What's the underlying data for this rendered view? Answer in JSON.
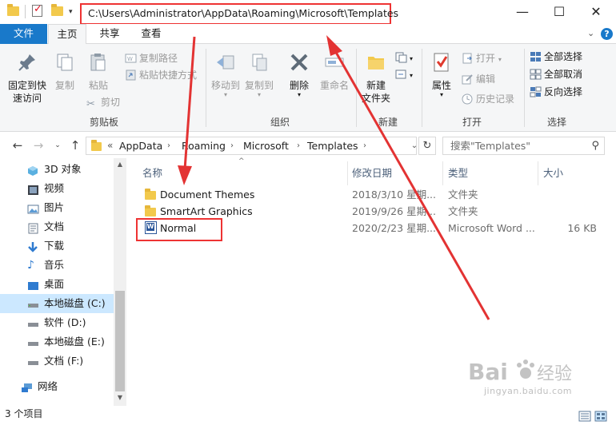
{
  "window": {
    "title_path": "C:\\Users\\Administrator\\AppData\\Roaming\\Microsoft\\Templates",
    "controls": {
      "minimize": "—",
      "maximize": "☐",
      "close": "✕"
    }
  },
  "ribbon_tabs": {
    "file": "文件",
    "home": "主页",
    "share": "共享",
    "view": "查看"
  },
  "ribbon": {
    "clipboard": {
      "label": "剪贴板",
      "pin": "固定到快\n速访问",
      "copy": "复制",
      "paste": "粘贴",
      "copy_path": "复制路径",
      "paste_shortcut": "粘贴快捷方式",
      "cut": "剪切"
    },
    "organize": {
      "label": "组织",
      "move_to": "移动到",
      "copy_to": "复制到",
      "delete": "删除",
      "rename": "重命名"
    },
    "new": {
      "label": "新建",
      "new_folder": "新建\n文件夹"
    },
    "open": {
      "label": "打开",
      "properties": "属性",
      "open": "打开",
      "edit": "编辑",
      "history": "历史记录"
    },
    "select": {
      "label": "选择",
      "select_all": "全部选择",
      "select_none": "全部取消",
      "invert": "反向选择"
    }
  },
  "address": {
    "breadcrumbs": [
      "AppData",
      "Roaming",
      "Microsoft",
      "Templates"
    ],
    "overflow": "«",
    "search_placeholder": "搜索\"Templates\""
  },
  "nav_pane": {
    "items": [
      {
        "label": "3D 对象",
        "icon": "cube-3d-icon"
      },
      {
        "label": "视频",
        "icon": "video-icon"
      },
      {
        "label": "图片",
        "icon": "pictures-icon"
      },
      {
        "label": "文档",
        "icon": "documents-icon"
      },
      {
        "label": "下载",
        "icon": "download-icon"
      },
      {
        "label": "音乐",
        "icon": "music-icon"
      },
      {
        "label": "桌面",
        "icon": "desktop-icon"
      },
      {
        "label": "本地磁盘 (C:)",
        "icon": "drive-icon"
      },
      {
        "label": "软件 (D:)",
        "icon": "drive-icon"
      },
      {
        "label": "本地磁盘 (E:)",
        "icon": "drive-icon"
      },
      {
        "label": "文档 (F:)",
        "icon": "drive-icon"
      },
      {
        "label": "网络",
        "icon": "network-icon"
      }
    ]
  },
  "file_list": {
    "columns": {
      "name": "名称",
      "modified": "修改日期",
      "type": "类型",
      "size": "大小"
    },
    "rows": [
      {
        "name": "Document Themes",
        "modified": "2018/3/10 星期...",
        "type": "文件夹",
        "size": "",
        "icon": "folder-icon"
      },
      {
        "name": "SmartArt Graphics",
        "modified": "2019/9/26 星期...",
        "type": "文件夹",
        "size": "",
        "icon": "folder-icon"
      },
      {
        "name": "Normal",
        "modified": "2020/2/23 星期...",
        "type": "Microsoft Word ...",
        "size": "16 KB",
        "icon": "word-document-icon"
      }
    ]
  },
  "status": {
    "item_count": "3 个项目"
  },
  "watermark": {
    "brand": "Baidu经验",
    "url": "jingyan.baidu.com"
  },
  "colors": {
    "accent": "#1979ca",
    "annotation": "#e33333",
    "selected": "#cce8ff"
  }
}
